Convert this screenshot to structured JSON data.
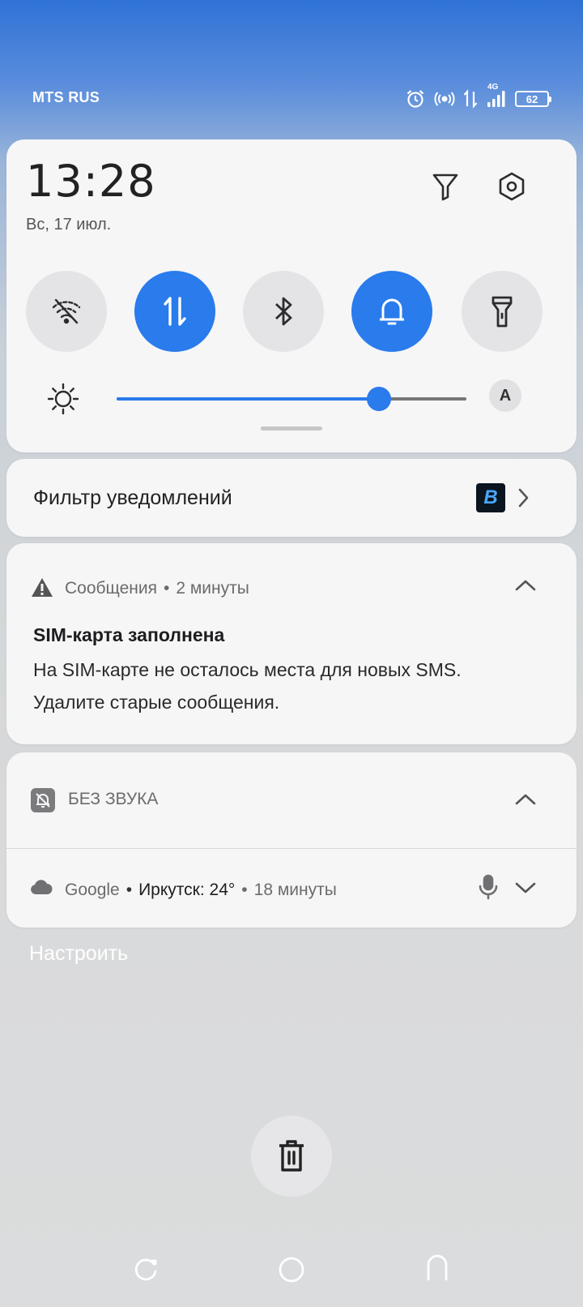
{
  "status_bar": {
    "carrier": "MTS RUS",
    "network": "4G",
    "battery": "62",
    "icons": [
      "alarm-icon",
      "hotspot-icon",
      "data-arrows-icon",
      "signal-icon",
      "battery-icon"
    ]
  },
  "quick_settings": {
    "time": "13:28",
    "date": "Вс, 17 июл.",
    "toggles": [
      {
        "name": "wifi",
        "icon": "wifi-off-icon",
        "active": false
      },
      {
        "name": "mobile-data",
        "icon": "data-transfer-icon",
        "active": true
      },
      {
        "name": "bluetooth",
        "icon": "bluetooth-icon",
        "active": false
      },
      {
        "name": "sound",
        "icon": "bell-icon",
        "active": true
      },
      {
        "name": "flashlight",
        "icon": "flashlight-icon",
        "active": false
      }
    ],
    "brightness": 0.75,
    "auto_brightness_label": "A"
  },
  "filter_card": {
    "label": "Фильтр уведомлений"
  },
  "sms_notification": {
    "app": "Сообщения",
    "separator": "•",
    "time": "2 минуты",
    "title": "SIM-карта заполнена",
    "body": "На SIM-карте не осталось места для новых SMS. Удалите старые сообщения."
  },
  "silent_section": {
    "label": "БЕЗ ЗВУКА",
    "notification": {
      "app": "Google",
      "sep1": "•",
      "content": "Иркутск: 24°",
      "sep2": "•",
      "time": "18 минуты"
    }
  },
  "customize_label": "Настроить",
  "colors": {
    "accent": "#2a7bec",
    "card_bg": "#f6f6f7",
    "tile_off": "#e4e4e6"
  }
}
